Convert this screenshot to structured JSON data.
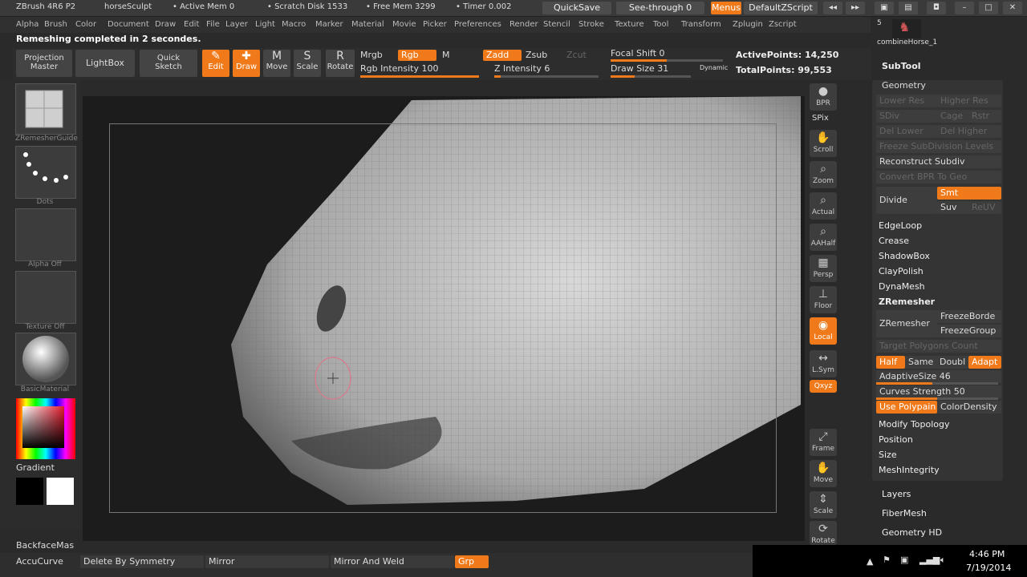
{
  "title_bar": {
    "app": "ZBrush 4R6 P2",
    "doc": "horseSculpt",
    "active_mem": "• Active Mem 0",
    "scratch_disk": "• Scratch Disk 1533",
    "free_mem": "• Free Mem 3299",
    "timer": "• Timer 0.002",
    "quicksave": "QuickSave",
    "see_through": "See-through  0",
    "menus": "Menus",
    "default_zscript": "DefaultZScript"
  },
  "menu": [
    "Alpha",
    "Brush",
    "Color",
    "Document",
    "Draw",
    "Edit",
    "File",
    "Layer",
    "Light",
    "Macro",
    "Marker",
    "Material",
    "Movie",
    "Picker",
    "Preferences",
    "Render",
    "Stencil",
    "Stroke",
    "Texture",
    "Tool",
    "Transform",
    "Zplugin",
    "Zscript"
  ],
  "notice": "Remeshing completed in 2 secondes.",
  "toolbar": {
    "projection_master": [
      "Projection",
      "Master"
    ],
    "lightbox": "LightBox",
    "quick_sketch": [
      "Quick",
      "Sketch"
    ],
    "edit": "Edit",
    "draw": "Draw",
    "move": "Move",
    "scale": "Scale",
    "rotate": "Rotate",
    "mrgb": "Mrgb",
    "rgb": "Rgb",
    "m": "M",
    "zadd": "Zadd",
    "zsub": "Zsub",
    "zcut": "Zcut",
    "rgb_intensity": "Rgb Intensity 100",
    "z_intensity": "Z Intensity 6",
    "focal_shift": "Focal Shift 0",
    "draw_size": "Draw Size 31",
    "dynamic": "Dynamic",
    "active_points": "ActivePoints: 14,250",
    "total_points": "TotalPoints: 99,553"
  },
  "left_panel": {
    "brush": "ZRemesherGuide",
    "stroke": "Dots",
    "alpha": "Alpha Off",
    "texture": "Texture Off",
    "material": "BasicMaterial",
    "gradient": "Gradient",
    "backface": "BackfaceMas",
    "accucurve": "AccuCurve"
  },
  "right_strip": [
    "BPR",
    "SPix",
    "Scroll",
    "Zoom",
    "Actual",
    "AAHalf",
    "Persp",
    "Floor",
    "Local",
    "L.Sym",
    "Qxyz",
    "Frame",
    "Move",
    "Scale",
    "Rotate"
  ],
  "palette": {
    "tool_count": "5",
    "tool_name": "combineHorse_1",
    "subtool": "SubTool",
    "geometry": "Geometry",
    "lower_res": "Lower Res",
    "higher_res": "Higher Res",
    "sdiv": "SDiv",
    "cage": "Cage",
    "rstr": "Rstr",
    "del_lower": "Del Lower",
    "del_higher": "Del Higher",
    "freeze_subdiv": "Freeze SubDivision Levels",
    "reconstruct": "Reconstruct Subdiv",
    "convert_bpr": "Convert BPR To Geo",
    "divide": "Divide",
    "smt": "Smt",
    "suv": "Suv",
    "reuv": "ReUV",
    "edgeloop": "EdgeLoop",
    "crease": "Crease",
    "shadowbox": "ShadowBox",
    "claypolish": "ClayPolish",
    "dynamesh": "DynaMesh",
    "zremesher_head": "ZRemesher",
    "zremesher_btn": "ZRemesher",
    "freeze_border": "FreezeBorde",
    "freeze_groups": "FreezeGroup",
    "target_polys": "Target Polygons Count",
    "half": "Half",
    "same": "Same",
    "double": "Doubl",
    "adapt": "Adapt",
    "adaptive_size": "AdaptiveSize 46",
    "curves_strength": "Curves Strength 50",
    "use_polypaint": "Use Polypain",
    "color_density": "ColorDensity",
    "modify_topology": "Modify Topology",
    "position": "Position",
    "size": "Size",
    "mesh_integrity": "MeshIntegrity",
    "layers": "Layers",
    "fibermesh": "FiberMesh",
    "geometry_hd": "Geometry HD"
  },
  "bottom": {
    "delete_symmetry": "Delete By Symmetry",
    "mirror": "Mirror",
    "mirror_weld": "Mirror And Weld",
    "grp": "Grp"
  },
  "taskbar": {
    "time": "4:46 PM",
    "date": "7/19/2014"
  },
  "colors": {
    "accent": "#f07a1a"
  }
}
